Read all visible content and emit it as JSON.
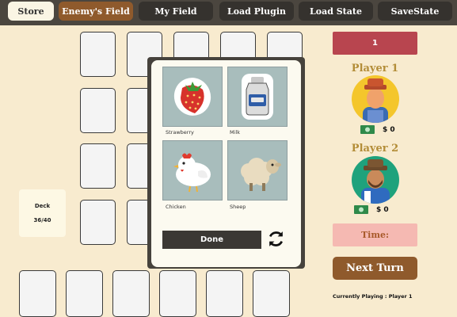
{
  "nav": {
    "store": "Store",
    "enemy_field": "Enemy's Field",
    "my_field": "My Field",
    "load_plugin": "Load Plugin",
    "load_state": "Load State",
    "save_state": "SaveState"
  },
  "deck": {
    "label": "Deck",
    "count": "36/40"
  },
  "shop_modal": {
    "items": [
      {
        "label": "Strawberry",
        "icon": "strawberry-icon"
      },
      {
        "label": "Milk",
        "icon": "milk-bottle-icon"
      },
      {
        "label": "Chicken",
        "icon": "chicken-icon"
      },
      {
        "label": "Sheep",
        "icon": "sheep-icon"
      }
    ],
    "done_label": "Done",
    "refresh_icon": "refresh-icon"
  },
  "sidebar": {
    "turn_counter": "1",
    "players": [
      {
        "name": "Player 1",
        "money": "$ 0"
      },
      {
        "name": "Player 2",
        "money": "$ 0"
      }
    ],
    "timer_label": "Time:",
    "next_turn_label": "Next Turn",
    "current_player": "Currently Playing : Player 1"
  },
  "colors": {
    "background": "#f8ebcf",
    "topbar": "#4b463f",
    "accent": "#8f5a2c",
    "counter": "#b8454f",
    "timer": "#f5b9b2",
    "player_title": "#b38d38"
  }
}
